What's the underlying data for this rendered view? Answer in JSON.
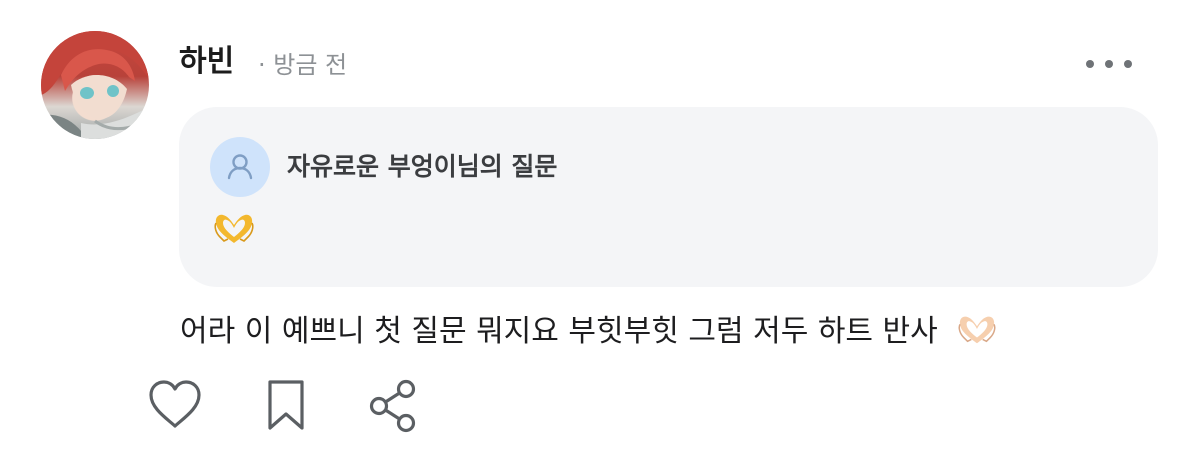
{
  "post": {
    "author": "하빈",
    "time": "· 방금 전",
    "more_icon": "more-horizontal-icon"
  },
  "question": {
    "asker": "자유로운 부엉이님의 질문",
    "body_icon": "heart-hands-emoji",
    "colors": {
      "box": "#f4f5f7",
      "avatar_bg": "#cfe3fb"
    }
  },
  "answer": {
    "text": "어라 이 예쁘니 첫 질문 뭐지요 부힛부힛 그럼 저두 하트 반사",
    "trailing_icon": "heart-hands-emoji"
  },
  "actions": {
    "icons": [
      "heart-icon",
      "bookmark-icon",
      "share-icon"
    ]
  }
}
